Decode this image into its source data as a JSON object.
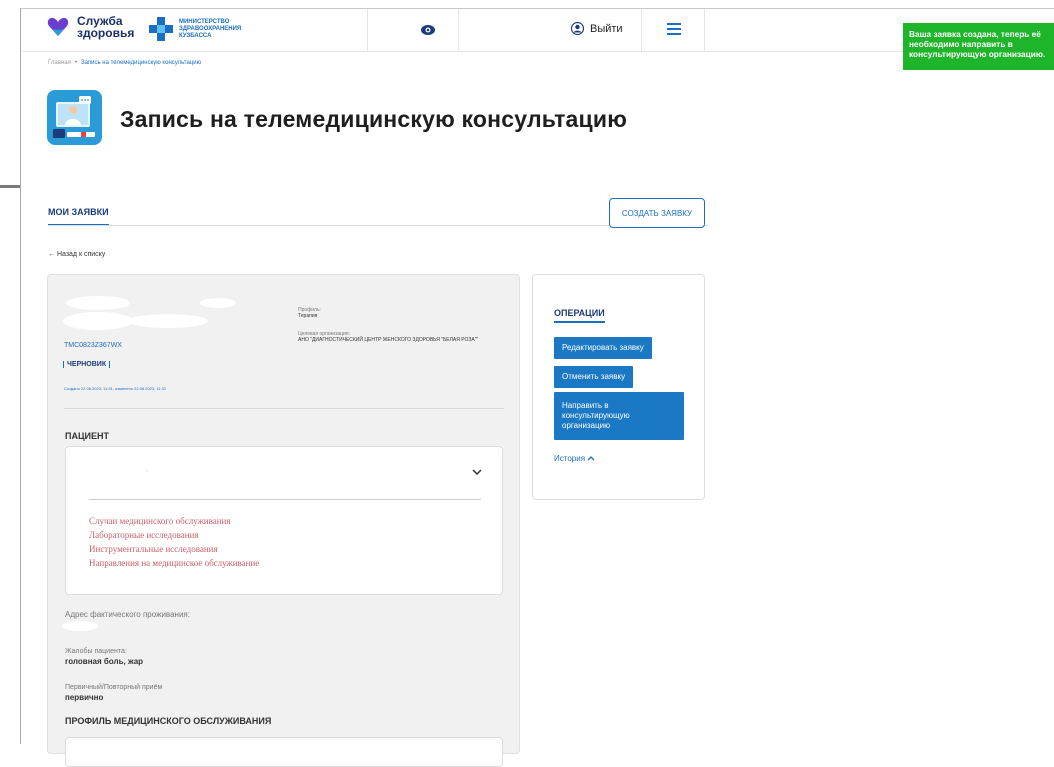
{
  "header": {
    "logo_line1": "Служба",
    "logo_line2": "здоровья",
    "ministry_line1": "МИНИСТЕРСТВО",
    "ministry_line2": "ЗДРАВООХРАНЕНИЯ",
    "ministry_line3": "КУЗБАССА",
    "logout_label": "Выйти"
  },
  "toast": {
    "message": "Ваша заявка создана, теперь её необходимо направить в консультирующую организацию."
  },
  "breadcrumb": {
    "home": "Главная",
    "current": "Запись на телемедицинскую консультацию"
  },
  "page": {
    "title": "Запись на телемедицинскую консультацию"
  },
  "tabs": {
    "my_requests": "МОИ ЗАЯВКИ",
    "create_button": "СОЗДАТЬ ЗАЯВКУ"
  },
  "back_link": "← Назад к списку",
  "request": {
    "id": "TMC0823Z367WX",
    "status": "ЧЕРНОВИК",
    "dates": "Создано 22.08.2023, 11:31, изменено 22.08.2023, 11:31",
    "profile_label": "Профиль:",
    "profile_value": "Терапия",
    "org_label": "Целевая организация:",
    "org_value": "АНО \"ДИАГНОСТИЧЕСКИЙ ЦЕНТР ЖЕНСКОГО ЗДОРОВЬЯ \"БЕЛАЯ РОЗА\"\""
  },
  "patient": {
    "section_title": "ПАЦИЕНТ",
    "selected_dash": "-",
    "links": [
      "Случаи медицинского обслуживания",
      "Лабораторные исследования",
      "Инструментальные исследования",
      "Направления на медицинское обслуживание"
    ],
    "address_label": "Адрес фактического проживания:",
    "complaints_label": "Жалобы пациента:",
    "complaints_value": "головная боль, жар",
    "visit_label": "Первичный/Повторный приём",
    "visit_value": "первично"
  },
  "service_profile": {
    "section_title": "ПРОФИЛЬ МЕДИЦИНСКОГО ОБСЛУЖИВАНИЯ"
  },
  "operations": {
    "title": "ОПЕРАЦИИ",
    "edit": "Редактировать заявку",
    "cancel": "Отменить заявку",
    "send": "Направить в консультирующую организацию",
    "history": "История"
  },
  "colors": {
    "brand_blue": "#1b6fc2",
    "button_blue": "#1b78c4",
    "toast_green": "#1fb52a",
    "link_red": "#c9616b"
  }
}
